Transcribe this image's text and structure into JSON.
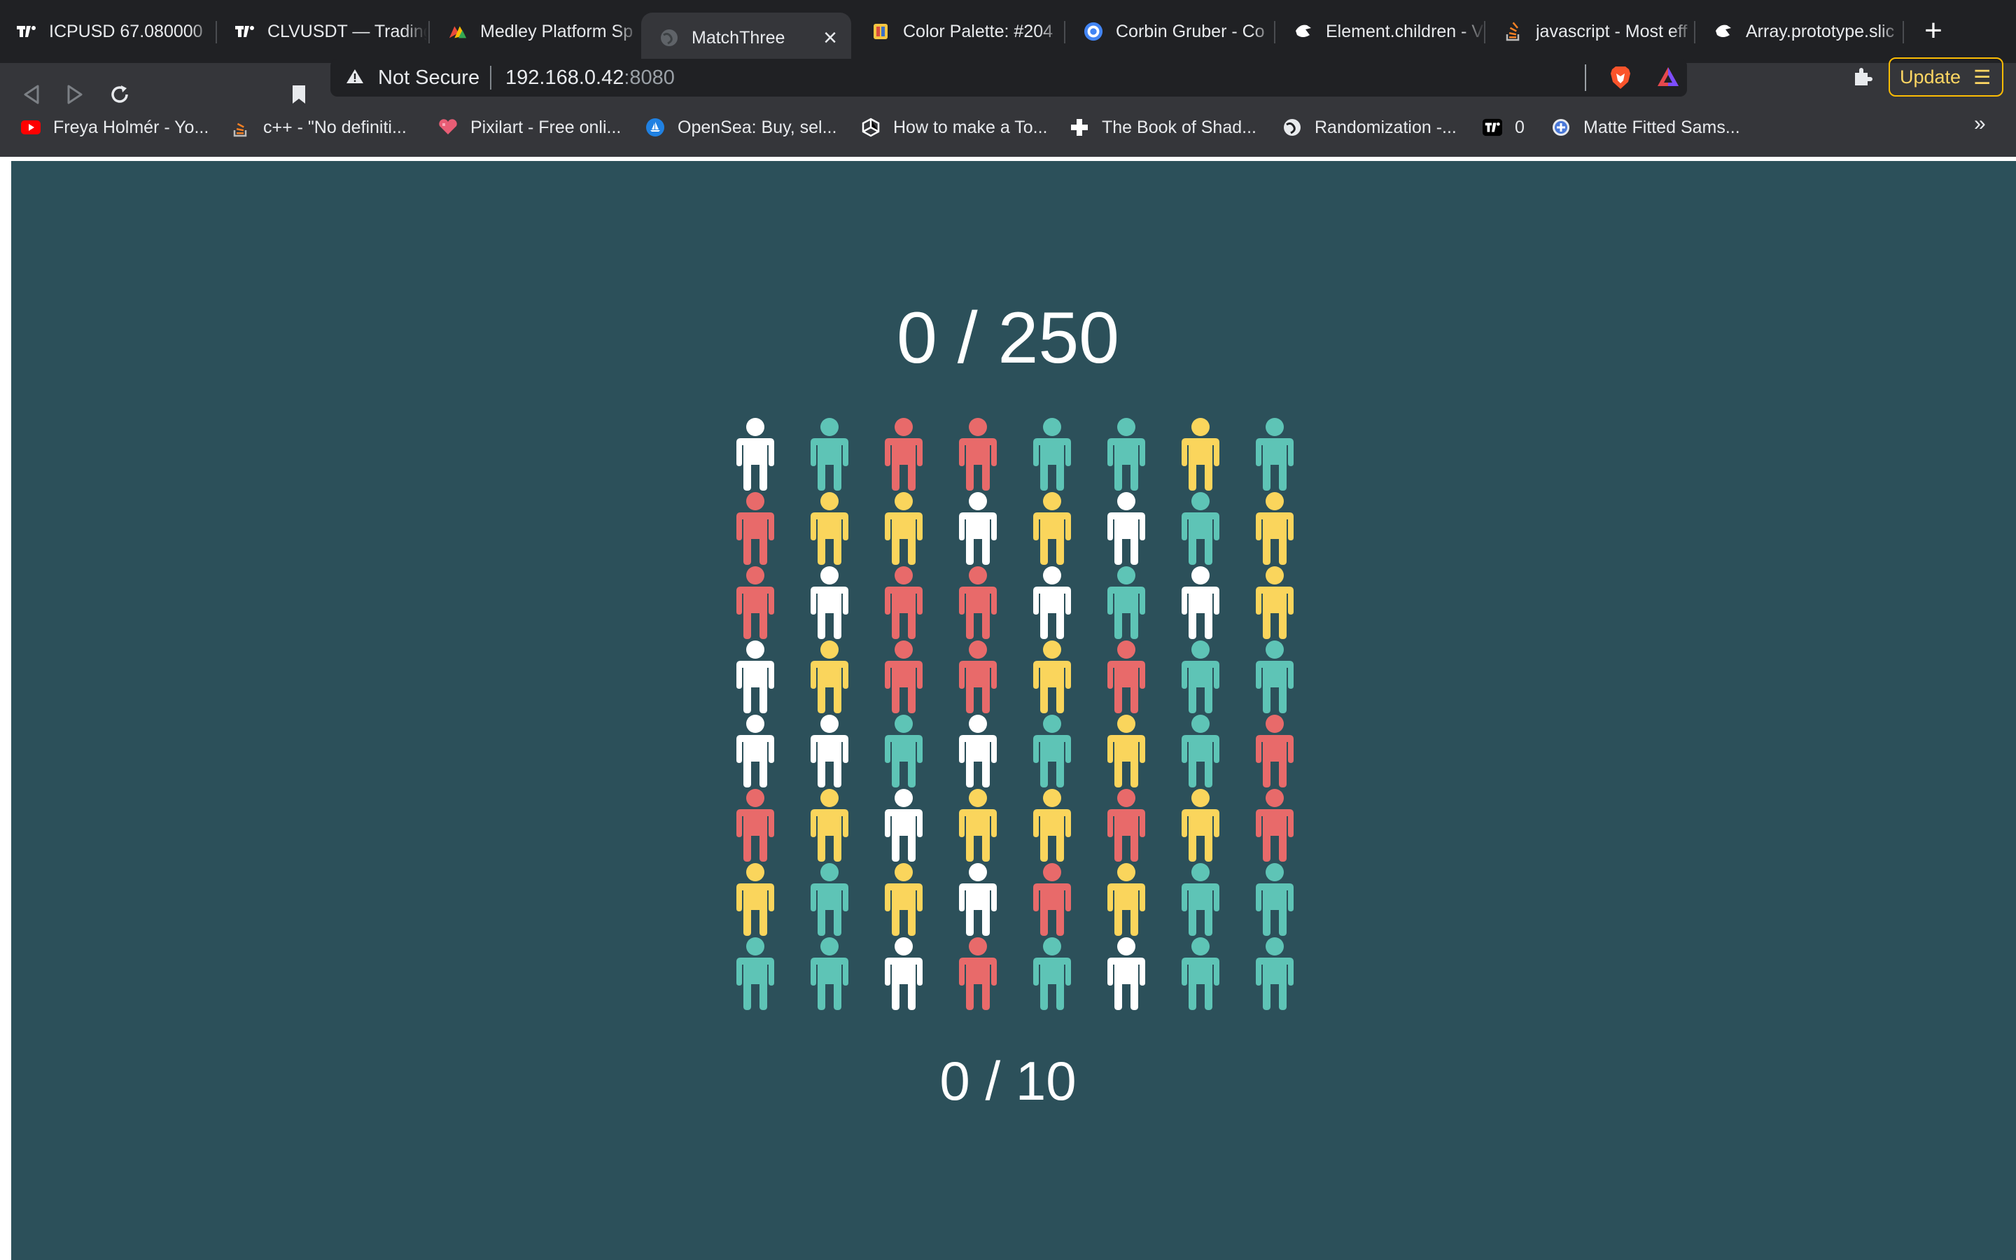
{
  "browser": {
    "tabs": [
      {
        "title": "ICPUSD 67.080000",
        "icon": "tradingview-icon",
        "active": false
      },
      {
        "title": "CLVUSDT — Trading",
        "icon": "tradingview-icon",
        "active": false
      },
      {
        "title": "Medley Platform Sp",
        "icon": "medley-icon",
        "active": false
      },
      {
        "title": "MatchThree",
        "icon": "globe-icon",
        "active": true
      },
      {
        "title": "Color Palette: #204",
        "icon": "palette-icon",
        "active": false
      },
      {
        "title": "Corbin Gruber - Co",
        "icon": "corbin-icon",
        "active": false
      },
      {
        "title": "Element.children - V",
        "icon": "mdn-icon",
        "active": false
      },
      {
        "title": "javascript - Most eff",
        "icon": "stackoverflow-icon",
        "active": false
      },
      {
        "title": "Array.prototype.slic",
        "icon": "mdn-icon",
        "active": false
      }
    ],
    "address": {
      "security_label": "Not Secure",
      "host": "192.168.0.42",
      "port": ":8080"
    },
    "update_label": "Update",
    "bookmarks": [
      {
        "label": "Freya Holmér - Yo...",
        "icon": "youtube-icon"
      },
      {
        "label": "c++ - \"No definiti...",
        "icon": "stackoverflow-icon"
      },
      {
        "label": "Pixilart - Free onli...",
        "icon": "pixilart-icon"
      },
      {
        "label": "OpenSea: Buy, sel...",
        "icon": "opensea-icon"
      },
      {
        "label": "How to make a To...",
        "icon": "unity-icon"
      },
      {
        "label": "The Book of Shad...",
        "icon": "cross-icon"
      },
      {
        "label": "Randomization -...",
        "icon": "globe-icon"
      },
      {
        "label": "0",
        "icon": "tradingview-icon"
      },
      {
        "label": "Matte Fitted Sams...",
        "icon": "plus-circle-icon"
      }
    ]
  },
  "game": {
    "score": "0 / 250",
    "moves": "0 / 10",
    "colors": {
      "W": "#ffffff",
      "T": "#5ec4b6",
      "R": "#e86a6a",
      "Y": "#fad55c"
    },
    "grid": [
      [
        "W",
        "T",
        "R",
        "R",
        "T",
        "T",
        "Y",
        "T"
      ],
      [
        "R",
        "Y",
        "Y",
        "W",
        "Y",
        "W",
        "T",
        "Y"
      ],
      [
        "R",
        "W",
        "R",
        "R",
        "W",
        "T",
        "W",
        "Y"
      ],
      [
        "W",
        "Y",
        "R",
        "R",
        "Y",
        "R",
        "T",
        "T"
      ],
      [
        "W",
        "W",
        "T",
        "W",
        "T",
        "Y",
        "T",
        "R"
      ],
      [
        "R",
        "Y",
        "W",
        "Y",
        "Y",
        "R",
        "Y",
        "R"
      ],
      [
        "Y",
        "T",
        "Y",
        "W",
        "R",
        "Y",
        "T",
        "T"
      ],
      [
        "T",
        "T",
        "W",
        "R",
        "T",
        "W",
        "T",
        "T"
      ]
    ]
  }
}
